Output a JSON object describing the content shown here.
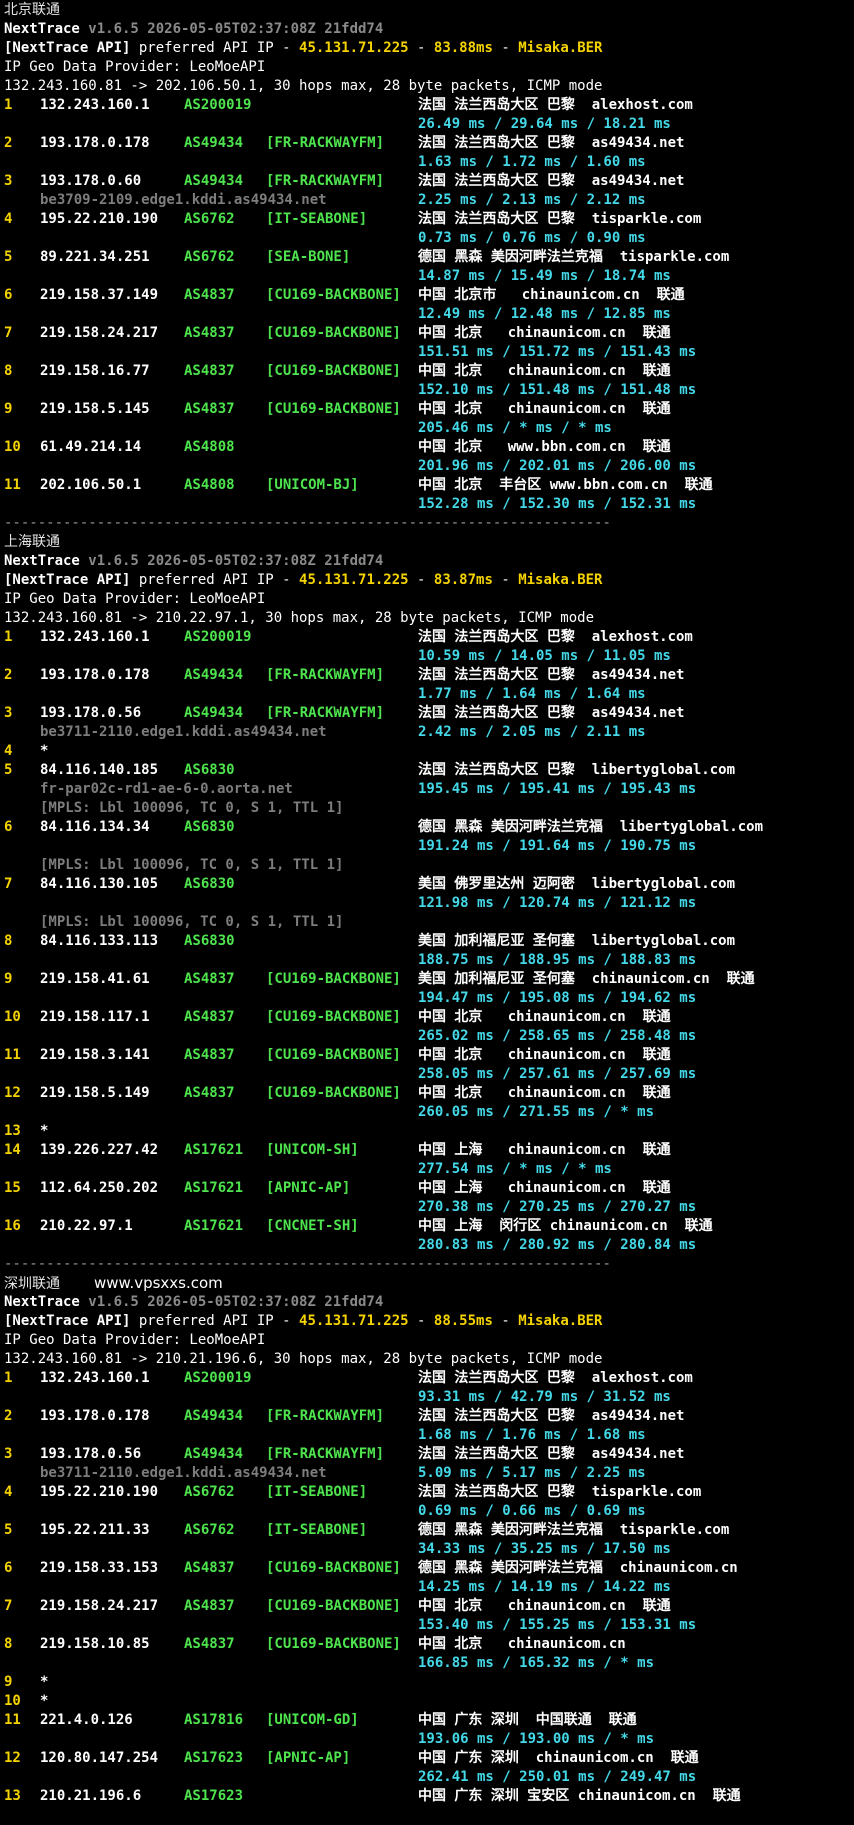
{
  "sections": [
    {
      "title": "北京联通",
      "site": "",
      "version": "v1.6.5 2026-05-05T02:37:08Z 21fdd74",
      "api_ip": "45.131.71.225",
      "api_ms": "83.88ms",
      "api_host": "Misaka.BER",
      "geo_provider": "IP Geo Data Provider: LeoMoeAPI",
      "route": "132.243.160.81 -> 202.106.50.1, 30 hops max, 28 byte packets, ICMP mode",
      "hops": [
        {
          "n": "1",
          "ip": "132.243.160.1",
          "as": "AS200019",
          "tag": "",
          "geo": "法国 法兰西岛大区 巴黎  alexhost.com",
          "rtt": "26.49 ms / 29.64 ms / 18.21 ms"
        },
        {
          "n": "2",
          "ip": "193.178.0.178",
          "as": "AS49434",
          "tag": "[FR-RACKWAYFM]",
          "geo": "法国 法兰西岛大区 巴黎  as49434.net",
          "rtt": "1.63 ms / 1.72 ms / 1.60 ms"
        },
        {
          "n": "3",
          "ip": "193.178.0.60",
          "as": "AS49434",
          "tag": "[FR-RACKWAYFM]",
          "geo": "法国 法兰西岛大区 巴黎  as49434.net",
          "sub": "be3709-2109.edge1.kddi.as49434.net",
          "rtt": "2.25 ms / 2.13 ms / 2.12 ms"
        },
        {
          "n": "4",
          "ip": "195.22.210.190",
          "as": "AS6762",
          "tag": "[IT-SEABONE]",
          "geo": "法国 法兰西岛大区 巴黎  tisparkle.com",
          "rtt": "0.73 ms / 0.76 ms / 0.90 ms"
        },
        {
          "n": "5",
          "ip": "89.221.34.251",
          "as": "AS6762",
          "tag": "[SEA-BONE]",
          "geo": "德国 黑森 美因河畔法兰克福  tisparkle.com",
          "rtt": "14.87 ms / 15.49 ms / 18.74 ms"
        },
        {
          "n": "6",
          "ip": "219.158.37.149",
          "as": "AS4837",
          "tag": "[CU169-BACKBONE]",
          "geo": "中国 北京市   chinaunicom.cn  联通",
          "rtt": "12.49 ms / 12.48 ms / 12.85 ms"
        },
        {
          "n": "7",
          "ip": "219.158.24.217",
          "as": "AS4837",
          "tag": "[CU169-BACKBONE]",
          "geo": "中国 北京   chinaunicom.cn  联通",
          "rtt": "151.51 ms / 151.72 ms / 151.43 ms"
        },
        {
          "n": "8",
          "ip": "219.158.16.77",
          "as": "AS4837",
          "tag": "[CU169-BACKBONE]",
          "geo": "中国 北京   chinaunicom.cn  联通",
          "rtt": "152.10 ms / 151.48 ms / 151.48 ms"
        },
        {
          "n": "9",
          "ip": "219.158.5.145",
          "as": "AS4837",
          "tag": "[CU169-BACKBONE]",
          "geo": "中国 北京   chinaunicom.cn  联通",
          "rtt": "205.46 ms / * ms / * ms"
        },
        {
          "n": "10",
          "ip": "61.49.214.14",
          "as": "AS4808",
          "tag": "",
          "geo": "中国 北京   www.bbn.com.cn  联通",
          "rtt": "201.96 ms / 202.01 ms / 206.00 ms"
        },
        {
          "n": "11",
          "ip": "202.106.50.1",
          "as": "AS4808",
          "tag": "[UNICOM-BJ]",
          "geo": "中国 北京  丰台区 www.bbn.com.cn  联通",
          "rtt": "152.28 ms / 152.30 ms / 152.31 ms"
        }
      ]
    },
    {
      "title": "上海联通",
      "site": "",
      "version": "v1.6.5 2026-05-05T02:37:08Z 21fdd74",
      "api_ip": "45.131.71.225",
      "api_ms": "83.87ms",
      "api_host": "Misaka.BER",
      "geo_provider": "IP Geo Data Provider: LeoMoeAPI",
      "route": "132.243.160.81 -> 210.22.97.1, 30 hops max, 28 byte packets, ICMP mode",
      "hops": [
        {
          "n": "1",
          "ip": "132.243.160.1",
          "as": "AS200019",
          "tag": "",
          "geo": "法国 法兰西岛大区 巴黎  alexhost.com",
          "rtt": "10.59 ms / 14.05 ms / 11.05 ms"
        },
        {
          "n": "2",
          "ip": "193.178.0.178",
          "as": "AS49434",
          "tag": "[FR-RACKWAYFM]",
          "geo": "法国 法兰西岛大区 巴黎  as49434.net",
          "rtt": "1.77 ms / 1.64 ms / 1.64 ms"
        },
        {
          "n": "3",
          "ip": "193.178.0.56",
          "as": "AS49434",
          "tag": "[FR-RACKWAYFM]",
          "geo": "法国 法兰西岛大区 巴黎  as49434.net",
          "sub": "be3711-2110.edge1.kddi.as49434.net",
          "rtt": "2.42 ms / 2.05 ms / 2.11 ms"
        },
        {
          "n": "4",
          "ip": "*",
          "as": "",
          "tag": "",
          "geo": "",
          "star": true
        },
        {
          "n": "5",
          "ip": "84.116.140.185",
          "as": "AS6830",
          "tag": "",
          "geo": "法国 法兰西岛大区 巴黎  libertyglobal.com",
          "sub": "fr-par02c-rd1-ae-6-0.aorta.net",
          "rtt": "195.45 ms / 195.41 ms / 195.43 ms",
          "mpls": "[MPLS: Lbl 100096, TC 0, S 1, TTL 1]"
        },
        {
          "n": "6",
          "ip": "84.116.134.34",
          "as": "AS6830",
          "tag": "",
          "geo": "德国 黑森 美因河畔法兰克福  libertyglobal.com",
          "rtt": "191.24 ms / 191.64 ms / 190.75 ms",
          "mpls2": "[MPLS: Lbl 100096, TC 0, S 1, TTL 1]"
        },
        {
          "n": "7",
          "ip": "84.116.130.105",
          "as": "AS6830",
          "tag": "",
          "geo": "美国 佛罗里达州 迈阿密  libertyglobal.com",
          "rtt": "121.98 ms / 120.74 ms / 121.12 ms",
          "mpls2": "[MPLS: Lbl 100096, TC 0, S 1, TTL 1]"
        },
        {
          "n": "8",
          "ip": "84.116.133.113",
          "as": "AS6830",
          "tag": "",
          "geo": "美国 加利福尼亚 圣何塞  libertyglobal.com",
          "rtt": "188.75 ms / 188.95 ms / 188.83 ms"
        },
        {
          "n": "9",
          "ip": "219.158.41.61",
          "as": "AS4837",
          "tag": "[CU169-BACKBONE]",
          "geo": "美国 加利福尼亚 圣何塞  chinaunicom.cn  联通",
          "rtt": "194.47 ms / 195.08 ms / 194.62 ms"
        },
        {
          "n": "10",
          "ip": "219.158.117.1",
          "as": "AS4837",
          "tag": "[CU169-BACKBONE]",
          "geo": "中国 北京   chinaunicom.cn  联通",
          "rtt": "265.02 ms / 258.65 ms / 258.48 ms"
        },
        {
          "n": "11",
          "ip": "219.158.3.141",
          "as": "AS4837",
          "tag": "[CU169-BACKBONE]",
          "geo": "中国 北京   chinaunicom.cn  联通",
          "rtt": "258.05 ms / 257.61 ms / 257.69 ms"
        },
        {
          "n": "12",
          "ip": "219.158.5.149",
          "as": "AS4837",
          "tag": "[CU169-BACKBONE]",
          "geo": "中国 北京   chinaunicom.cn  联通",
          "rtt": "260.05 ms / 271.55 ms / * ms"
        },
        {
          "n": "13",
          "ip": "*",
          "as": "",
          "tag": "",
          "geo": "",
          "star": true
        },
        {
          "n": "14",
          "ip": "139.226.227.42",
          "as": "AS17621",
          "tag": "[UNICOM-SH]",
          "geo": "中国 上海   chinaunicom.cn  联通",
          "rtt": "277.54 ms / * ms / * ms"
        },
        {
          "n": "15",
          "ip": "112.64.250.202",
          "as": "AS17621",
          "tag": "[APNIC-AP]",
          "geo": "中国 上海   chinaunicom.cn  联通",
          "rtt": "270.38 ms / 270.25 ms / 270.27 ms"
        },
        {
          "n": "16",
          "ip": "210.22.97.1",
          "as": "AS17621",
          "tag": "[CNCNET-SH]",
          "geo": "中国 上海  闵行区 chinaunicom.cn  联通",
          "rtt": "280.83 ms / 280.92 ms / 280.84 ms"
        }
      ]
    },
    {
      "title": "深圳联通",
      "site": "www.vpsxxs.com",
      "version": "v1.6.5 2026-05-05T02:37:08Z 21fdd74",
      "api_ip": "45.131.71.225",
      "api_ms": "88.55ms",
      "api_host": "Misaka.BER",
      "geo_provider": "IP Geo Data Provider: LeoMoeAPI",
      "route": "132.243.160.81 -> 210.21.196.6, 30 hops max, 28 byte packets, ICMP mode",
      "hops": [
        {
          "n": "1",
          "ip": "132.243.160.1",
          "as": "AS200019",
          "tag": "",
          "geo": "法国 法兰西岛大区 巴黎  alexhost.com",
          "rtt": "93.31 ms / 42.79 ms / 31.52 ms"
        },
        {
          "n": "2",
          "ip": "193.178.0.178",
          "as": "AS49434",
          "tag": "[FR-RACKWAYFM]",
          "geo": "法国 法兰西岛大区 巴黎  as49434.net",
          "rtt": "1.68 ms / 1.76 ms / 1.68 ms"
        },
        {
          "n": "3",
          "ip": "193.178.0.56",
          "as": "AS49434",
          "tag": "[FR-RACKWAYFM]",
          "geo": "法国 法兰西岛大区 巴黎  as49434.net",
          "sub": "be3711-2110.edge1.kddi.as49434.net",
          "rtt": "5.09 ms / 5.17 ms / 2.25 ms"
        },
        {
          "n": "4",
          "ip": "195.22.210.190",
          "as": "AS6762",
          "tag": "[IT-SEABONE]",
          "geo": "法国 法兰西岛大区 巴黎  tisparkle.com",
          "rtt": "0.69 ms / 0.66 ms / 0.69 ms"
        },
        {
          "n": "5",
          "ip": "195.22.211.33",
          "as": "AS6762",
          "tag": "[IT-SEABONE]",
          "geo": "德国 黑森 美因河畔法兰克福  tisparkle.com",
          "rtt": "34.33 ms / 35.25 ms / 17.50 ms"
        },
        {
          "n": "6",
          "ip": "219.158.33.153",
          "as": "AS4837",
          "tag": "[CU169-BACKBONE]",
          "geo": "德国 黑森 美因河畔法兰克福  chinaunicom.cn",
          "rtt": "14.25 ms / 14.19 ms / 14.22 ms"
        },
        {
          "n": "7",
          "ip": "219.158.24.217",
          "as": "AS4837",
          "tag": "[CU169-BACKBONE]",
          "geo": "中国 北京   chinaunicom.cn  联通",
          "rtt": "153.40 ms / 155.25 ms / 153.31 ms"
        },
        {
          "n": "8",
          "ip": "219.158.10.85",
          "as": "AS4837",
          "tag": "[CU169-BACKBONE]",
          "geo": "中国 北京   chinaunicom.cn",
          "rtt": "166.85 ms / 165.32 ms / * ms"
        },
        {
          "n": "9",
          "ip": "*",
          "as": "",
          "tag": "",
          "geo": "",
          "star": true
        },
        {
          "n": "10",
          "ip": "*",
          "as": "",
          "tag": "",
          "geo": "",
          "star": true
        },
        {
          "n": "11",
          "ip": "221.4.0.126",
          "as": "AS17816",
          "tag": "[UNICOM-GD]",
          "geo": "中国 广东 深圳  中国联通  联通",
          "rtt": "193.06 ms / 193.00 ms / * ms"
        },
        {
          "n": "12",
          "ip": "120.80.147.254",
          "as": "AS17623",
          "tag": "[APNIC-AP]",
          "geo": "中国 广东 深圳  chinaunicom.cn  联通",
          "rtt": "262.41 ms / 250.01 ms / 249.47 ms"
        },
        {
          "n": "13",
          "ip": "210.21.196.6",
          "as": "AS17623",
          "tag": "",
          "geo": "中国 广东 深圳 宝安区 chinaunicom.cn  联通",
          "rtt": ""
        }
      ]
    }
  ],
  "labels": {
    "app": "NextTrace",
    "api_prefix": "[NextTrace API]",
    "api_mid": " preferred API IP - ",
    "dash": " - ",
    "separator": "------------------------------------------------------------------------"
  }
}
